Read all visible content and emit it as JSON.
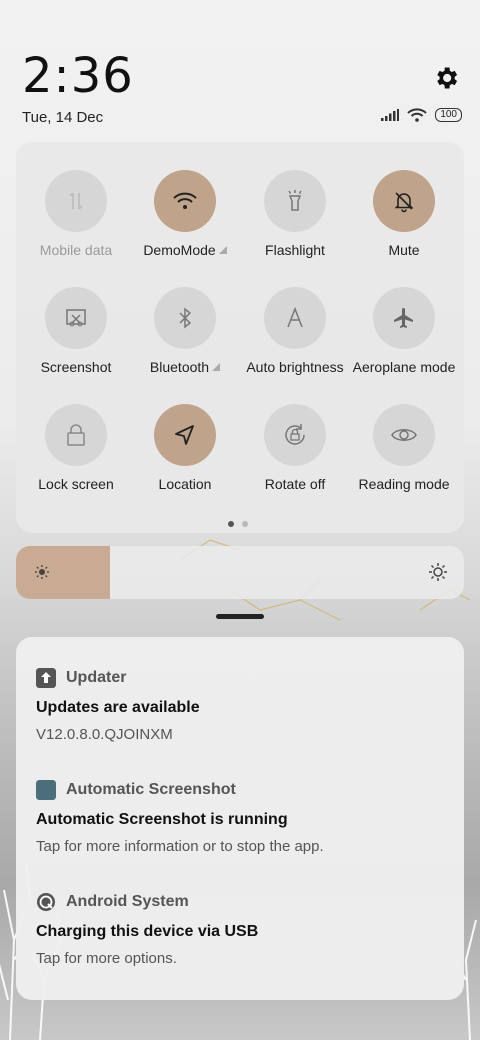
{
  "status_bar": {
    "time": "2:36",
    "date": "Tue, 14 Dec",
    "battery": "100"
  },
  "quick_settings": {
    "tiles": [
      {
        "label": "Mobile data",
        "icon": "mobile-data-icon",
        "state": "disabled"
      },
      {
        "label": "DemoMode",
        "icon": "wifi-icon",
        "state": "on",
        "expandable": true
      },
      {
        "label": "Flashlight",
        "icon": "flashlight-icon",
        "state": "off"
      },
      {
        "label": "Mute",
        "icon": "mute-bell-icon",
        "state": "on"
      },
      {
        "label": "Screenshot",
        "icon": "screenshot-icon",
        "state": "off"
      },
      {
        "label": "Bluetooth",
        "icon": "bluetooth-icon",
        "state": "off",
        "expandable": true
      },
      {
        "label": "Auto brightness",
        "icon": "auto-brightness-icon",
        "state": "off"
      },
      {
        "label": "Aeroplane mode",
        "icon": "airplane-icon",
        "state": "off"
      },
      {
        "label": "Lock screen",
        "icon": "lock-icon",
        "state": "off"
      },
      {
        "label": "Location",
        "icon": "location-icon",
        "state": "on"
      },
      {
        "label": "Rotate off",
        "icon": "rotate-icon",
        "state": "off"
      },
      {
        "label": "Reading mode",
        "icon": "eye-icon",
        "state": "off"
      }
    ],
    "page_count": 2,
    "current_page": 1
  },
  "brightness": {
    "level": 0.21
  },
  "notifications": [
    {
      "app": "Updater",
      "title": "Updates are available",
      "text": "V12.0.8.0.QJOINXM",
      "icon": "updater-icon"
    },
    {
      "app": "Automatic Screenshot",
      "title": "Automatic Screenshot is running",
      "text": "Tap for more information or to stop the app.",
      "icon": "screenshot-app-icon"
    },
    {
      "app": "Android System",
      "title": "Charging this device via USB",
      "text": "Tap for more options.",
      "icon": "android-system-icon"
    }
  ],
  "colors": {
    "tile_on": "#bfa38a",
    "tile_off": "#d6d6d6",
    "brightness_fill": "#c8ab92"
  }
}
